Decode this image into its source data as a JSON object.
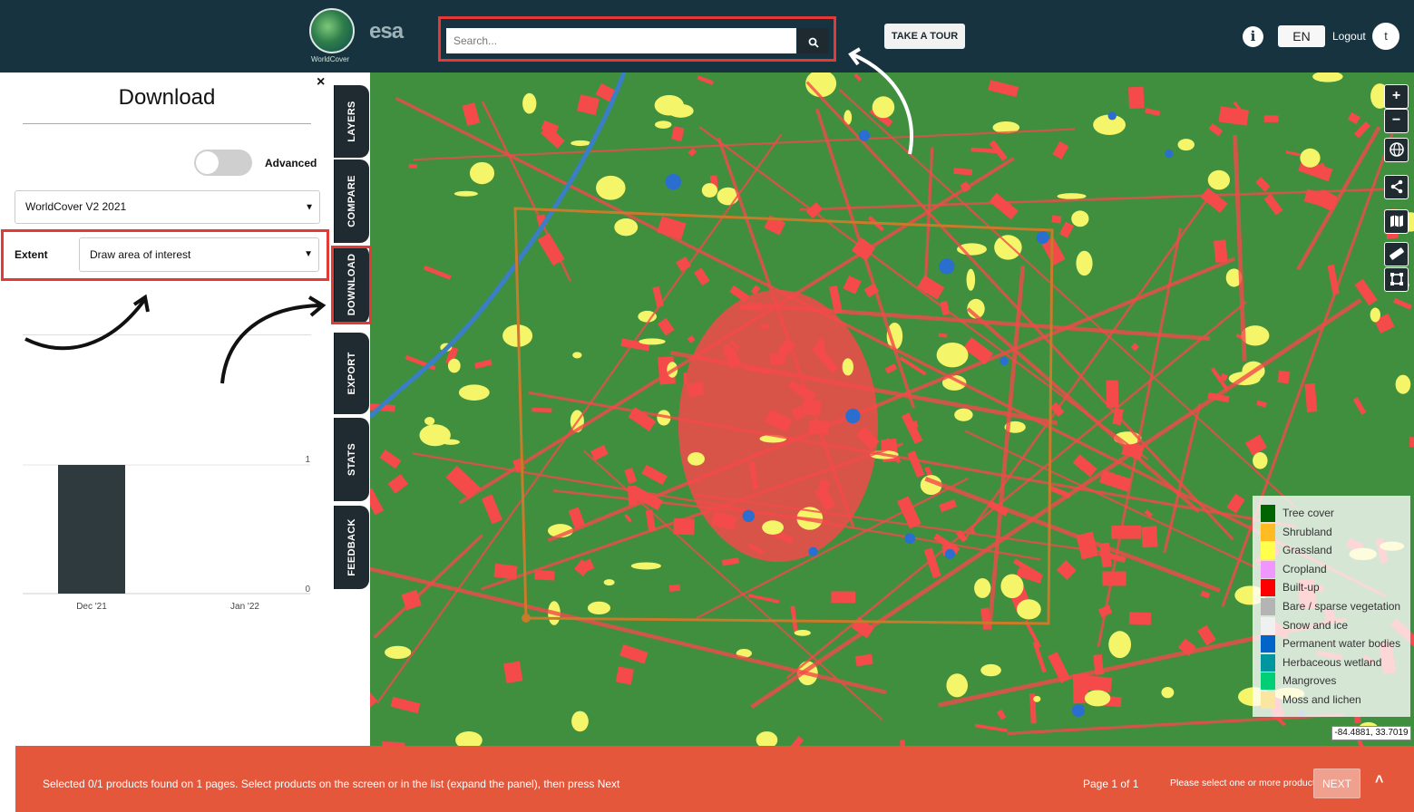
{
  "header": {
    "logo_text": "WorldCover",
    "partner_logo": "esa",
    "search_placeholder": "Search...",
    "tour_label": "TAKE A TOUR",
    "info_icon": "i",
    "language": "EN",
    "logout_label": "Logout",
    "user_initial": "t"
  },
  "panel": {
    "title": "Download",
    "close_icon": "×",
    "advanced_label": "Advanced",
    "advanced_enabled": false,
    "product_select": "WorldCover V2 2021",
    "extent_label": "Extent",
    "extent_select": "Draw area of interest"
  },
  "tabs": [
    "LAYERS",
    "COMPARE",
    "DOWNLOAD",
    "EXPORT",
    "STATS",
    "FEEDBACK"
  ],
  "chart_data": {
    "type": "bar",
    "categories": [
      "Dec '21",
      "Jan '22"
    ],
    "values": [
      1,
      0
    ],
    "ylim": [
      0,
      1
    ],
    "yticks": [
      "1",
      "0"
    ],
    "bar_color": "#2f3a3f",
    "grid": true
  },
  "map": {
    "controls": [
      "+",
      "−",
      "globe-icon",
      "share-icon",
      "map-icon",
      "ruler-icon",
      "draw-area-icon"
    ],
    "coordinates": "-84.4881, 33.7019",
    "aoi_color": "#c97a2a"
  },
  "legend": [
    {
      "label": "Tree cover",
      "color": "#006400"
    },
    {
      "label": "Shrubland",
      "color": "#ffbb22"
    },
    {
      "label": "Grassland",
      "color": "#ffff4c"
    },
    {
      "label": "Cropland",
      "color": "#f096ff"
    },
    {
      "label": "Built-up",
      "color": "#fa0000"
    },
    {
      "label": "Bare / sparse vegetation",
      "color": "#b4b4b4"
    },
    {
      "label": "Snow and ice",
      "color": "#f0f0f0"
    },
    {
      "label": "Permanent water bodies",
      "color": "#0064c8"
    },
    {
      "label": "Herbaceous wetland",
      "color": "#0096a0"
    },
    {
      "label": "Mangroves",
      "color": "#00cf75"
    },
    {
      "label": "Moss and lichen",
      "color": "#fae6a0"
    }
  ],
  "bottom_bar": {
    "message": "Selected 0/1 products found on 1 pages. Select products on the screen or in the list (expand the panel), then press Next",
    "page": "Page 1 of 1",
    "hint": "Please select one or more products",
    "next_label": "NEXT",
    "expand_icon": "˄"
  }
}
